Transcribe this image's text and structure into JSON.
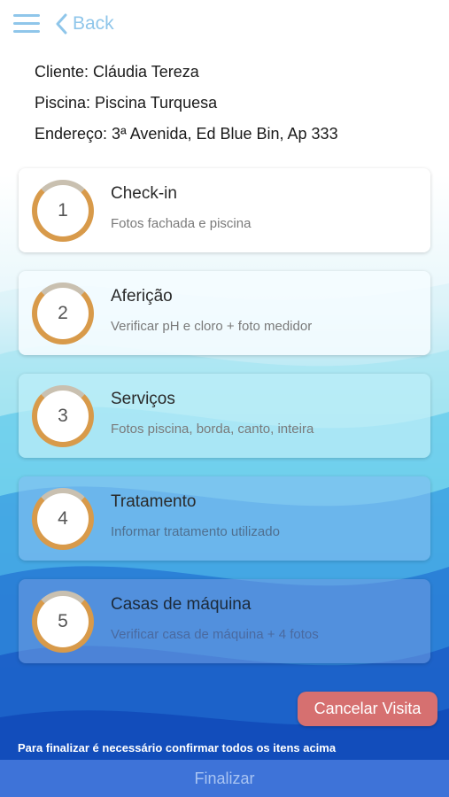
{
  "nav": {
    "back_label": "Back"
  },
  "visit": {
    "client": "Cliente: Cláudia Tereza",
    "pool": "Piscina: Piscina Turquesa",
    "address": "Endereço: 3ª Avenida, Ed Blue Bin, Ap 333"
  },
  "steps": [
    {
      "number": "1",
      "title": "Check-in",
      "subtitle": "Fotos fachada e piscina"
    },
    {
      "number": "2",
      "title": "Aferição",
      "subtitle": "Verificar pH e cloro + foto medidor"
    },
    {
      "number": "3",
      "title": "Serviços",
      "subtitle": "Fotos piscina, borda, canto, inteira"
    },
    {
      "number": "4",
      "title": "Tratamento",
      "subtitle": "Informar tratamento utilizado"
    },
    {
      "number": "5",
      "title": "Casas de máquina",
      "subtitle": "Verificar casa de máquina + 4 fotos"
    }
  ],
  "actions": {
    "cancel_label": "Cancelar Visita",
    "notice": "Para finalizar é necessário confirmar todos os itens acima",
    "finalize_label": "Finalizar"
  },
  "colors": {
    "accent": "#8fc6ea",
    "ring": "#d89a4a",
    "cancel": "#d67070",
    "finalize": "#3e73d8"
  },
  "icons": {
    "menu": "hamburger-menu-icon",
    "back": "chevron-left-icon"
  }
}
